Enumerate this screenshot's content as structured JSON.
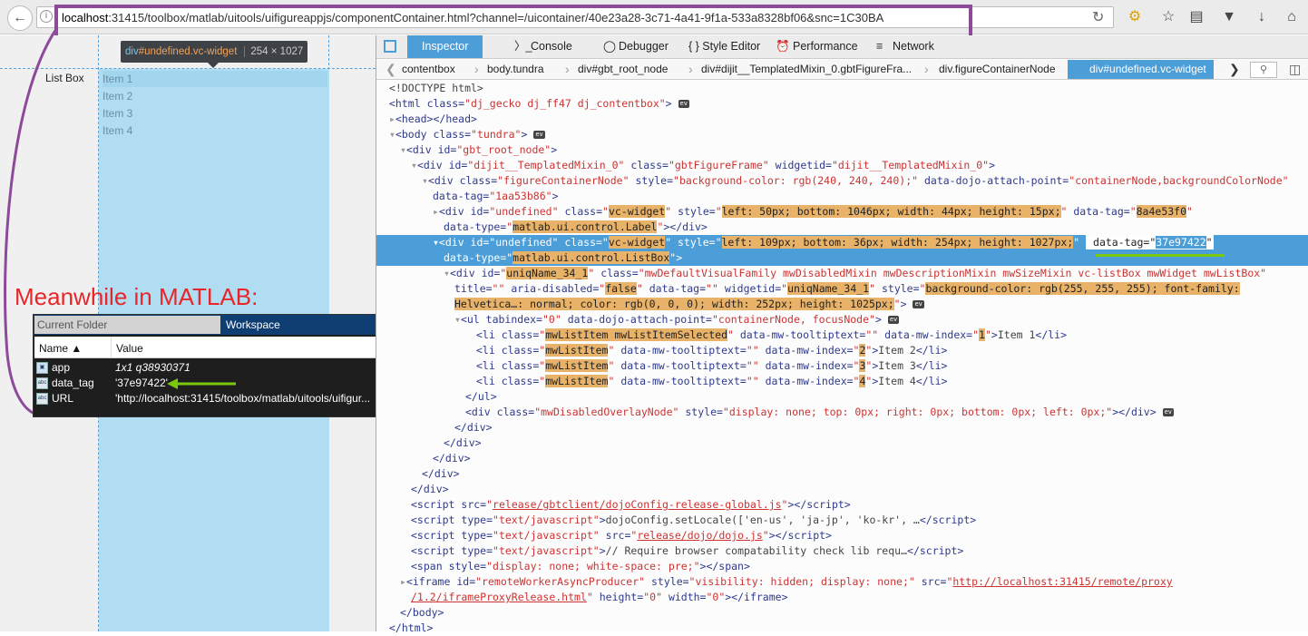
{
  "browser": {
    "url_host": "localhost",
    "url_rest": ":31415/toolbox/matlab/uitools/uifigureappjs/componentContainer.html?channel=/uicontainer/40e23a28-3c71-4a41-9f1a-533a8328bf06&snc=1C30BA"
  },
  "page": {
    "label_text": "List Box",
    "listbox_items": [
      "Item 1",
      "Item 2",
      "Item 3",
      "Item 4"
    ],
    "tooltip_tag": "div",
    "tooltip_id": "#undefined.vc-widget",
    "tooltip_dims": "254 × 1027"
  },
  "annotation": {
    "meanwhile": "Meanwhile in MATLAB:"
  },
  "matlab": {
    "tab_current_folder": "Current Folder",
    "tab_workspace": "Workspace",
    "col_name": "Name ▲",
    "col_value": "Value",
    "rows": [
      {
        "name": "app",
        "value": "1x1 q38930371",
        "icon": "object-icon"
      },
      {
        "name": "data_tag",
        "value": "'37e97422'",
        "icon": "char-icon"
      },
      {
        "name": "URL",
        "value": "'http://localhost:31415/toolbox/matlab/uitools/uifigur...",
        "icon": "char-icon"
      }
    ]
  },
  "devtools": {
    "tabs": [
      "Inspector",
      "Console",
      "Debugger",
      "{ } Style Editor",
      "Performance",
      "Network"
    ],
    "breadcrumbs": [
      "contentbox",
      "body.tundra",
      "div#gbt_root_node",
      "div#dijit__TemplatedMixin_0.gbtFigureFra...",
      "div.figureContainerNode",
      "div#undefined.vc-widget"
    ],
    "selected_data_tag": "37e97422"
  },
  "colors": {
    "devtools_accent": "#4c9ed9",
    "highlight": "#e8b269",
    "annotation_red": "#e8262a",
    "annotation_purple": "#8e4a9a",
    "arrow_green": "#7cc80d"
  }
}
